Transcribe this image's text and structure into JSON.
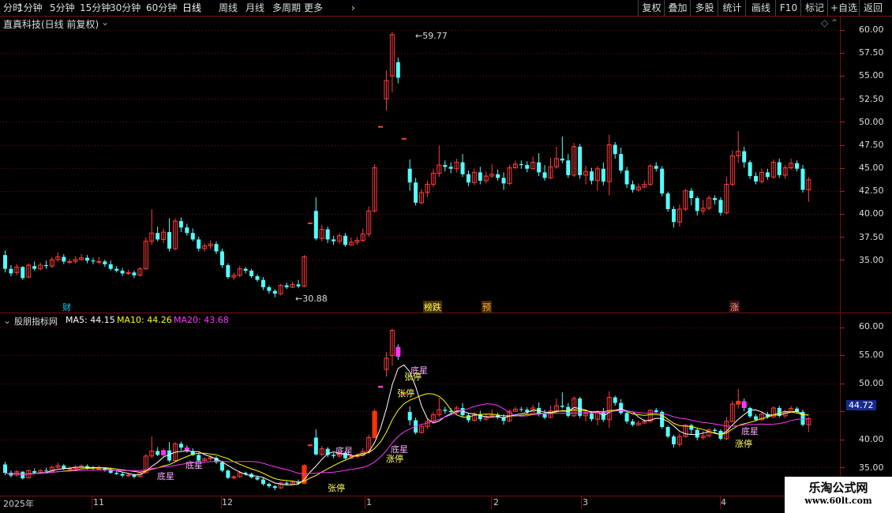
{
  "toolbar": {
    "periods": [
      "分时",
      "1分钟",
      "5分钟",
      "15分钟",
      "30分钟",
      "60分钟",
      "日线",
      "周线",
      "月线",
      "多周期",
      "更多"
    ],
    "active": "日线",
    "right": [
      "复权",
      "叠加",
      "多股",
      "统计",
      "画线",
      "F10",
      "标记",
      "+自选",
      "返回"
    ]
  },
  "main": {
    "title": "直真科技(日线 前复权)",
    "high_label": "59.77",
    "low_label": "30.88",
    "y_ticks": [
      "60.00",
      "57.50",
      "55.00",
      "52.50",
      "50.00",
      "47.50",
      "45.00",
      "42.50",
      "40.00",
      "37.50",
      "35.00"
    ],
    "events": [
      {
        "text": "财",
        "color": "#00d0ff",
        "bg": "#000"
      },
      {
        "text": "榜跌",
        "color": "#ffff66",
        "bg": "#5a3a00"
      },
      {
        "text": "预",
        "color": "#ffaa44",
        "bg": "#5a3000"
      },
      {
        "text": "涨",
        "color": "#ff9999",
        "bg": "#4a1010"
      }
    ]
  },
  "indicator": {
    "name": "股朋指标网",
    "ma5": "MA5: 44.15",
    "ma10": "MA10: 44.26",
    "ma20": "MA20: 43.68",
    "y_ticks": [
      "60.00",
      "55.00",
      "50.00",
      "45.00",
      "40.00",
      "35.00"
    ],
    "current": "44.72",
    "signals": [
      "张停",
      "涨停",
      "张停",
      "张停",
      "涨停",
      "张停",
      "涨停"
    ],
    "stars": [
      "底星",
      "底星",
      "底星",
      "底星",
      "底星",
      "底星"
    ],
    "colors": {
      "ma5": "#ffffff",
      "ma10": "#ffff00",
      "ma20": "#ff33ff"
    }
  },
  "dates": [
    "2025年",
    "11",
    "12",
    "1",
    "2",
    "3",
    "4"
  ],
  "watermark": {
    "title": "乐淘公式网",
    "url": "www.60lt.com"
  },
  "chart_data": {
    "type": "candlestick",
    "title": "直真科技(日线 前复权)",
    "ylim": [
      30,
      61
    ],
    "candles": [
      [
        35.5,
        34.0,
        36.0,
        33.6
      ],
      [
        34.0,
        33.5,
        34.4,
        33.2
      ],
      [
        33.6,
        34.2,
        34.5,
        33.3
      ],
      [
        34.2,
        33.0,
        34.3,
        32.8
      ],
      [
        33.1,
        34.4,
        34.6,
        33.0
      ],
      [
        34.3,
        34.0,
        34.8,
        33.8
      ],
      [
        34.0,
        34.4,
        34.7,
        33.8
      ],
      [
        34.4,
        34.3,
        34.9,
        34.0
      ],
      [
        34.3,
        35.0,
        35.3,
        34.1
      ],
      [
        35.0,
        35.3,
        35.8,
        34.8
      ],
      [
        35.3,
        34.8,
        35.6,
        34.5
      ],
      [
        34.8,
        34.8,
        35.1,
        34.5
      ],
      [
        34.8,
        35.0,
        35.4,
        34.6
      ],
      [
        35.0,
        35.2,
        35.6,
        34.9
      ],
      [
        35.2,
        34.9,
        35.5,
        34.6
      ],
      [
        34.9,
        34.8,
        35.2,
        34.5
      ],
      [
        34.8,
        34.8,
        35.3,
        34.5
      ],
      [
        34.8,
        34.5,
        35.0,
        34.2
      ],
      [
        34.5,
        34.0,
        34.9,
        33.8
      ],
      [
        34.0,
        33.8,
        34.3,
        33.6
      ],
      [
        33.8,
        33.5,
        34.1,
        33.2
      ],
      [
        33.5,
        33.6,
        33.9,
        33.3
      ],
      [
        33.6,
        33.3,
        33.8,
        33.0
      ],
      [
        33.3,
        34.0,
        34.2,
        33.2
      ],
      [
        34.0,
        37.0,
        37.4,
        33.9
      ],
      [
        37.0,
        37.9,
        40.5,
        36.6
      ],
      [
        37.9,
        37.2,
        38.6,
        37.0
      ],
      [
        37.2,
        38.0,
        38.4,
        36.8
      ],
      [
        38.0,
        36.2,
        39.5,
        35.9
      ],
      [
        36.2,
        39.2,
        39.5,
        36.0
      ],
      [
        39.2,
        38.5,
        39.6,
        38.0
      ],
      [
        38.5,
        37.9,
        38.9,
        37.6
      ],
      [
        37.9,
        37.2,
        38.4,
        37.0
      ],
      [
        37.2,
        36.2,
        37.5,
        35.9
      ],
      [
        36.2,
        36.5,
        36.8,
        35.9
      ],
      [
        36.5,
        36.7,
        37.1,
        36.2
      ],
      [
        36.7,
        35.9,
        37.0,
        35.6
      ],
      [
        35.9,
        34.4,
        36.2,
        34.1
      ],
      [
        34.4,
        33.1,
        34.6,
        32.9
      ],
      [
        33.1,
        33.3,
        33.6,
        32.8
      ],
      [
        33.3,
        34.0,
        34.3,
        33.1
      ],
      [
        34.0,
        33.8,
        34.2,
        33.5
      ],
      [
        33.8,
        33.2,
        34.0,
        33.0
      ],
      [
        33.2,
        32.8,
        33.4,
        32.6
      ],
      [
        32.8,
        32.0,
        33.1,
        31.7
      ],
      [
        32.0,
        31.6,
        32.2,
        31.3
      ],
      [
        31.6,
        31.3,
        31.8,
        30.9
      ],
      [
        31.3,
        32.2,
        32.4,
        31.1
      ],
      [
        32.2,
        32.0,
        32.5,
        31.8
      ],
      [
        32.0,
        32.3,
        32.6,
        31.9
      ],
      [
        32.3,
        32.1,
        32.8,
        31.9
      ],
      [
        32.1,
        35.3,
        35.5,
        32.0
      ],
      [
        39.0,
        39.0,
        39.0,
        39.0
      ],
      [
        40.3,
        37.3,
        41.8,
        37.1
      ],
      [
        37.3,
        38.3,
        38.8,
        37.0
      ],
      [
        38.3,
        37.2,
        38.6,
        36.8
      ],
      [
        37.2,
        37.0,
        37.6,
        36.6
      ],
      [
        37.0,
        37.6,
        37.9,
        36.7
      ],
      [
        37.6,
        36.6,
        37.9,
        36.4
      ],
      [
        36.6,
        36.9,
        37.4,
        36.5
      ],
      [
        36.9,
        37.1,
        37.5,
        36.6
      ],
      [
        37.1,
        37.8,
        38.4,
        36.9
      ],
      [
        37.8,
        40.3,
        40.8,
        37.5
      ],
      [
        40.3,
        45.0,
        45.4,
        40.1
      ],
      [
        49.5,
        49.5,
        49.5,
        49.5
      ],
      [
        52.5,
        54.5,
        55.6,
        51.2
      ],
      [
        55.0,
        59.5,
        59.8,
        53.2
      ],
      [
        56.5,
        54.8,
        57.0,
        54.2
      ],
      [
        48.2,
        48.2,
        48.2,
        48.2
      ],
      [
        44.9,
        43.4,
        45.9,
        42.5
      ],
      [
        43.4,
        41.2,
        43.9,
        40.9
      ],
      [
        41.2,
        42.3,
        42.7,
        41.0
      ],
      [
        42.3,
        43.2,
        43.6,
        41.8
      ],
      [
        43.2,
        44.4,
        44.9,
        42.9
      ],
      [
        44.4,
        45.3,
        47.4,
        44.0
      ],
      [
        45.3,
        45.1,
        45.8,
        44.6
      ],
      [
        45.1,
        44.9,
        45.6,
        44.4
      ],
      [
        44.9,
        45.6,
        46.0,
        44.5
      ],
      [
        45.6,
        44.3,
        46.5,
        44.0
      ],
      [
        44.3,
        43.4,
        44.7,
        43.0
      ],
      [
        43.4,
        44.5,
        44.9,
        43.1
      ],
      [
        44.5,
        43.6,
        45.1,
        43.2
      ],
      [
        43.6,
        44.1,
        44.6,
        43.3
      ],
      [
        44.1,
        44.3,
        45.4,
        43.9
      ],
      [
        44.3,
        43.9,
        44.8,
        43.6
      ],
      [
        43.9,
        43.3,
        44.5,
        42.6
      ],
      [
        43.3,
        45.0,
        45.3,
        43.1
      ],
      [
        45.0,
        45.4,
        45.8,
        44.9
      ],
      [
        45.4,
        45.3,
        45.8,
        44.9
      ],
      [
        45.3,
        44.9,
        45.7,
        44.5
      ],
      [
        44.9,
        45.6,
        46.2,
        44.8
      ],
      [
        45.6,
        44.5,
        46.6,
        44.1
      ],
      [
        44.5,
        43.9,
        45.3,
        43.6
      ],
      [
        43.9,
        45.1,
        46.1,
        43.8
      ],
      [
        45.1,
        46.0,
        47.3,
        44.9
      ],
      [
        46.0,
        45.8,
        48.4,
        45.5
      ],
      [
        45.8,
        44.2,
        46.5,
        43.9
      ],
      [
        44.2,
        47.3,
        47.7,
        44.0
      ],
      [
        47.3,
        44.2,
        47.6,
        43.8
      ],
      [
        44.2,
        44.6,
        45.2,
        43.2
      ],
      [
        44.6,
        43.6,
        45.0,
        43.2
      ],
      [
        43.6,
        44.9,
        45.2,
        42.5
      ],
      [
        44.9,
        43.5,
        45.6,
        43.1
      ],
      [
        43.5,
        47.5,
        48.6,
        42.0
      ],
      [
        47.5,
        46.5,
        47.8,
        46.0
      ],
      [
        46.5,
        44.7,
        47.2,
        44.4
      ],
      [
        44.7,
        43.2,
        45.1,
        42.8
      ],
      [
        43.2,
        42.6,
        43.6,
        42.3
      ],
      [
        42.6,
        42.9,
        43.3,
        42.4
      ],
      [
        42.9,
        43.2,
        43.6,
        42.8
      ],
      [
        43.2,
        45.2,
        45.4,
        43.0
      ],
      [
        45.2,
        44.9,
        45.6,
        44.6
      ],
      [
        44.9,
        42.2,
        45.2,
        41.9
      ],
      [
        42.2,
        40.5,
        42.4,
        40.2
      ],
      [
        40.5,
        39.1,
        40.8,
        38.5
      ],
      [
        39.1,
        40.5,
        41.0,
        38.6
      ],
      [
        40.5,
        42.5,
        42.7,
        40.3
      ],
      [
        42.5,
        41.7,
        42.8,
        40.9
      ],
      [
        41.7,
        40.3,
        41.9,
        39.8
      ],
      [
        40.3,
        40.6,
        41.5,
        39.9
      ],
      [
        40.6,
        41.7,
        42.0,
        40.4
      ],
      [
        41.7,
        41.5,
        42.0,
        41.0
      ],
      [
        41.5,
        40.1,
        41.8,
        39.8
      ],
      [
        40.1,
        43.2,
        44.0,
        39.9
      ],
      [
        43.2,
        46.3,
        46.9,
        43.0
      ],
      [
        46.3,
        46.8,
        49.0,
        45.5
      ],
      [
        46.8,
        45.6,
        47.3,
        45.0
      ],
      [
        45.6,
        44.1,
        45.8,
        43.8
      ],
      [
        44.1,
        43.5,
        44.5,
        43.2
      ],
      [
        43.5,
        44.5,
        44.9,
        43.3
      ],
      [
        44.5,
        44.0,
        44.9,
        43.7
      ],
      [
        44.0,
        45.6,
        45.9,
        43.8
      ],
      [
        45.6,
        44.2,
        46.0,
        43.9
      ],
      [
        44.2,
        45.0,
        45.3,
        43.8
      ],
      [
        45.0,
        45.5,
        46.0,
        44.8
      ],
      [
        45.5,
        44.9,
        45.8,
        44.6
      ],
      [
        44.9,
        42.6,
        45.3,
        42.3
      ],
      [
        42.6,
        43.7,
        44.0,
        41.3
      ]
    ]
  }
}
